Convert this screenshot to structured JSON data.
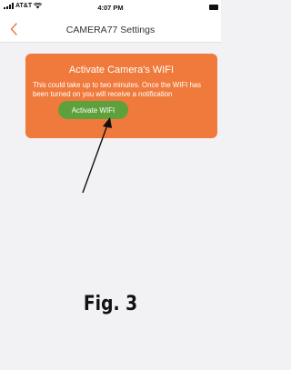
{
  "status_bar": {
    "carrier": "AT&T",
    "time": "4:07 PM",
    "signal_icon": "cellular-signal-icon",
    "wifi_icon": "wifi-icon",
    "battery_icon": "battery-icon"
  },
  "nav": {
    "title": "CAMERA77 Settings",
    "back_icon": "chevron-left-icon"
  },
  "panel": {
    "title": "Activate Camera's WIFI",
    "message": "This could take up to two minutes. Once the WIFI has been turned on you will receive a notification",
    "button_label": "Activate WIFI"
  },
  "caption": "Fig. 3",
  "colors": {
    "accent": "#f07a3c",
    "button": "#5ea03c",
    "background": "#f2f2f4",
    "back_chevron": "#f0763a"
  }
}
